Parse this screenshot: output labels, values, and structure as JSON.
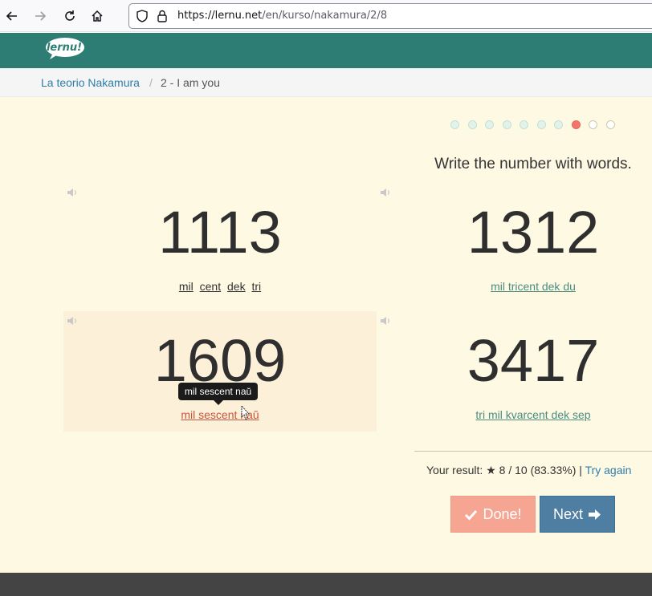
{
  "browser": {
    "url_host": "https://lernu.net",
    "url_path": "/en/kurso/nakamura/2/8"
  },
  "site": {
    "logo_text": "lernu!",
    "brand_color": "#2e7d74"
  },
  "breadcrumb": {
    "parent": "La teorio Nakamura",
    "separator": "/",
    "current": "2 - I am you"
  },
  "progress": {
    "total": 10,
    "current_index": 8,
    "completed": 7
  },
  "exercise": {
    "instruction": "Write the number with words.",
    "cards": [
      {
        "number": "1113",
        "answer_words": [
          "mil",
          "cent",
          "dek",
          "tri"
        ]
      },
      {
        "number": "1312",
        "answer": "mil tricent dek du"
      },
      {
        "number": "1609",
        "answer": "mil sescent naŭ"
      },
      {
        "number": "3417",
        "answer": "tri mil kvarcent dek sep"
      }
    ],
    "tooltip": "mil sescent naŭ"
  },
  "result": {
    "label": "Your result:",
    "star": "★",
    "score": "8 / 10 (83.33%)",
    "separator": "|",
    "try_again": "Try again"
  },
  "buttons": {
    "done_label": "Done!",
    "next_label": "Next"
  }
}
